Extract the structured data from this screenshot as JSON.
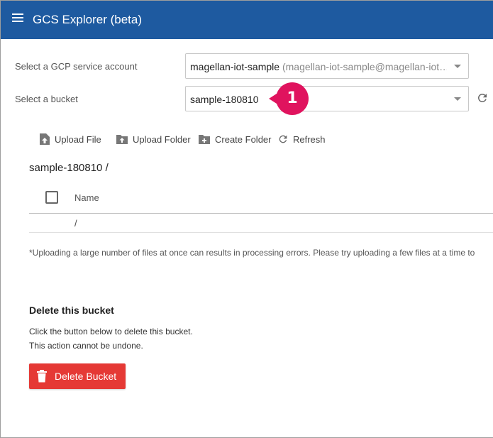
{
  "app": {
    "title": "GCS Explorer (beta)"
  },
  "form": {
    "service_account_label": "Select a GCP service account",
    "service_account_value": "magellan-iot-sample",
    "service_account_detail": " (magellan-iot-sample@magellan-iot…",
    "bucket_label": "Select a bucket",
    "bucket_value": "sample-180810"
  },
  "annotation": {
    "step": "1"
  },
  "toolbar": {
    "upload_file": "Upload File",
    "upload_folder": "Upload Folder",
    "create_folder": "Create Folder",
    "refresh": "Refresh"
  },
  "browser": {
    "path": "sample-180810 /",
    "column_name": "Name",
    "rows": [
      {
        "name": "/"
      }
    ],
    "note": "*Uploading a large number of files at once can results in processing errors. Please try uploading a few files at a time to"
  },
  "delete_section": {
    "title": "Delete this bucket",
    "line1": "Click the button below to delete this bucket.",
    "line2": "This action cannot be undone.",
    "button": "Delete Bucket"
  },
  "colors": {
    "appbar": "#1e5aa0",
    "badge": "#e0135e",
    "danger": "#e53935"
  },
  "icons": [
    "menu-icon",
    "refresh-icon",
    "upload-file-icon",
    "upload-folder-icon",
    "create-folder-icon",
    "trash-icon"
  ]
}
